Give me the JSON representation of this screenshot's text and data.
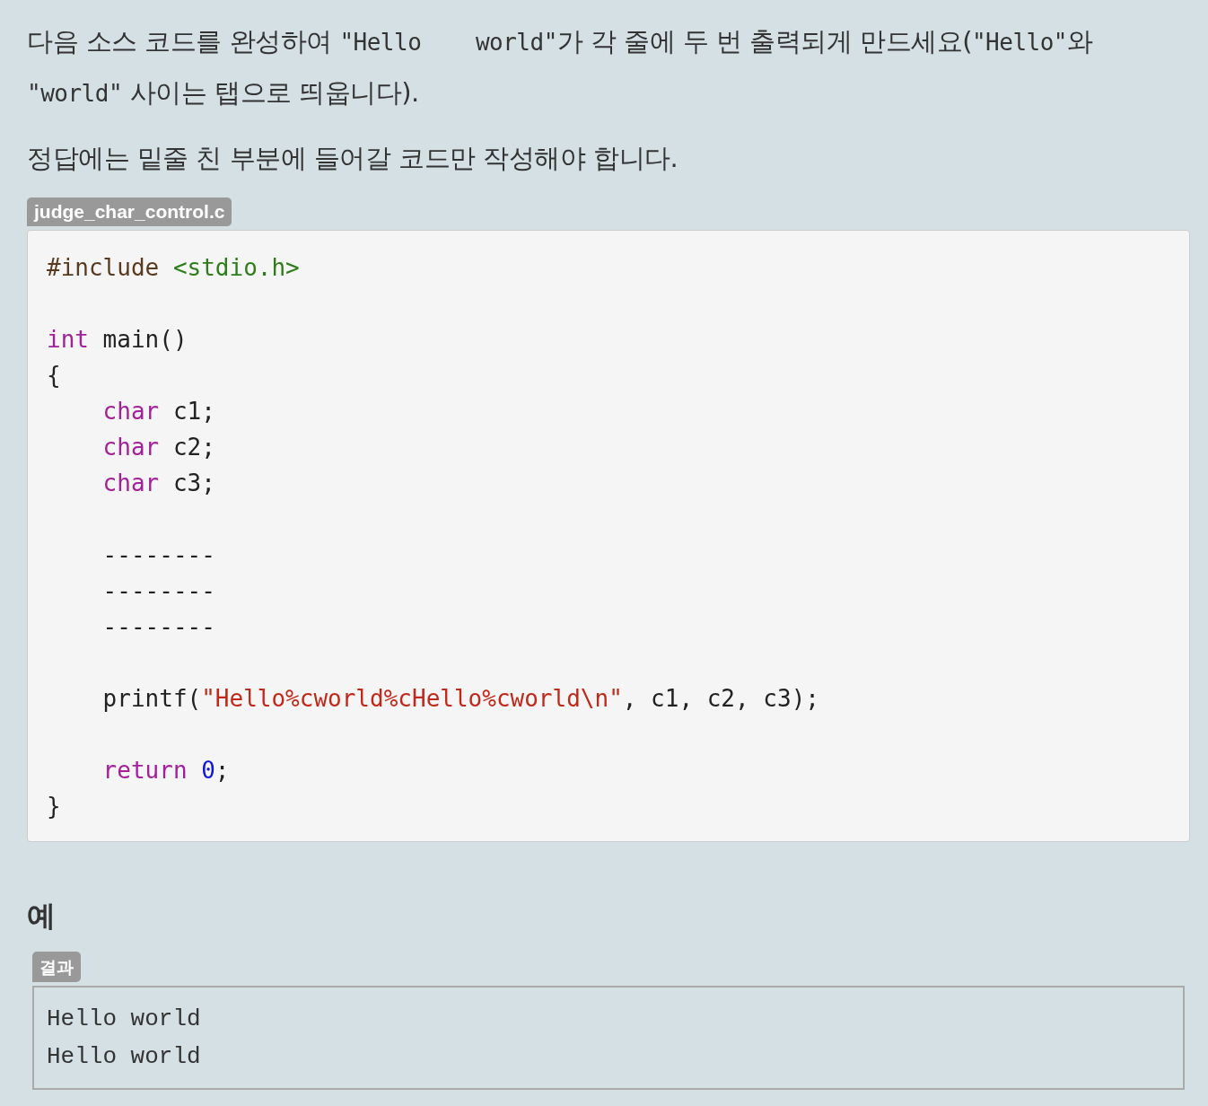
{
  "instructions": [
    {
      "segments": [
        {
          "kind": "text",
          "text": "다음 소스 코드를 완성하여 "
        },
        {
          "kind": "code",
          "text": "\"Hello    world\""
        },
        {
          "kind": "text",
          "text": "가 각 줄에 두 번 출력되게 만드세요("
        },
        {
          "kind": "code",
          "text": "\"Hello\""
        },
        {
          "kind": "text",
          "text": "와 "
        },
        {
          "kind": "code",
          "text": "\"world\""
        },
        {
          "kind": "text",
          "text": " 사이는 탭으로 띄웁니다)."
        }
      ]
    },
    {
      "segments": [
        {
          "kind": "text",
          "text": "정답에는 밑줄 친 부분에 들어갈 코드만 작성해야 합니다."
        }
      ]
    }
  ],
  "code_file": {
    "filename": "judge_char_control.c",
    "lines": [
      {
        "kind": "code",
        "tokens": [
          {
            "kind": "preproc",
            "text": "#include "
          },
          {
            "kind": "header",
            "text": "<stdio.h>"
          }
        ]
      },
      {
        "kind": "blank"
      },
      {
        "kind": "code",
        "tokens": [
          {
            "kind": "keyword",
            "text": "int"
          },
          {
            "kind": "plain",
            "text": " main()"
          }
        ]
      },
      {
        "kind": "code",
        "tokens": [
          {
            "kind": "plain",
            "text": "{"
          }
        ]
      },
      {
        "kind": "code",
        "tokens": [
          {
            "kind": "keyword",
            "text": "    char"
          },
          {
            "kind": "plain",
            "text": " c1;"
          }
        ]
      },
      {
        "kind": "code",
        "tokens": [
          {
            "kind": "keyword",
            "text": "    char"
          },
          {
            "kind": "plain",
            "text": " c2;"
          }
        ]
      },
      {
        "kind": "code",
        "tokens": [
          {
            "kind": "keyword",
            "text": "    char"
          },
          {
            "kind": "plain",
            "text": " c3;"
          }
        ]
      },
      {
        "kind": "blank"
      },
      {
        "kind": "code",
        "tokens": [
          {
            "kind": "plain",
            "text": "    --------"
          }
        ]
      },
      {
        "kind": "code",
        "tokens": [
          {
            "kind": "plain",
            "text": "    --------"
          }
        ]
      },
      {
        "kind": "code",
        "tokens": [
          {
            "kind": "plain",
            "text": "    --------"
          }
        ]
      },
      {
        "kind": "blank"
      },
      {
        "kind": "code",
        "tokens": [
          {
            "kind": "plain",
            "text": "    printf("
          },
          {
            "kind": "string",
            "text": "\"Hello%cworld%cHello%cworld\\n\""
          },
          {
            "kind": "plain",
            "text": ", c1, c2, c3);"
          }
        ]
      },
      {
        "kind": "blank"
      },
      {
        "kind": "code",
        "tokens": [
          {
            "kind": "keyword",
            "text": "    return"
          },
          {
            "kind": "number",
            "text": " 0"
          },
          {
            "kind": "plain",
            "text": ";"
          }
        ]
      },
      {
        "kind": "code",
        "tokens": [
          {
            "kind": "plain",
            "text": "}"
          }
        ]
      }
    ]
  },
  "example": {
    "heading": "예",
    "label": "결과",
    "output_lines": [
      "Hello world",
      "Hello world"
    ]
  }
}
